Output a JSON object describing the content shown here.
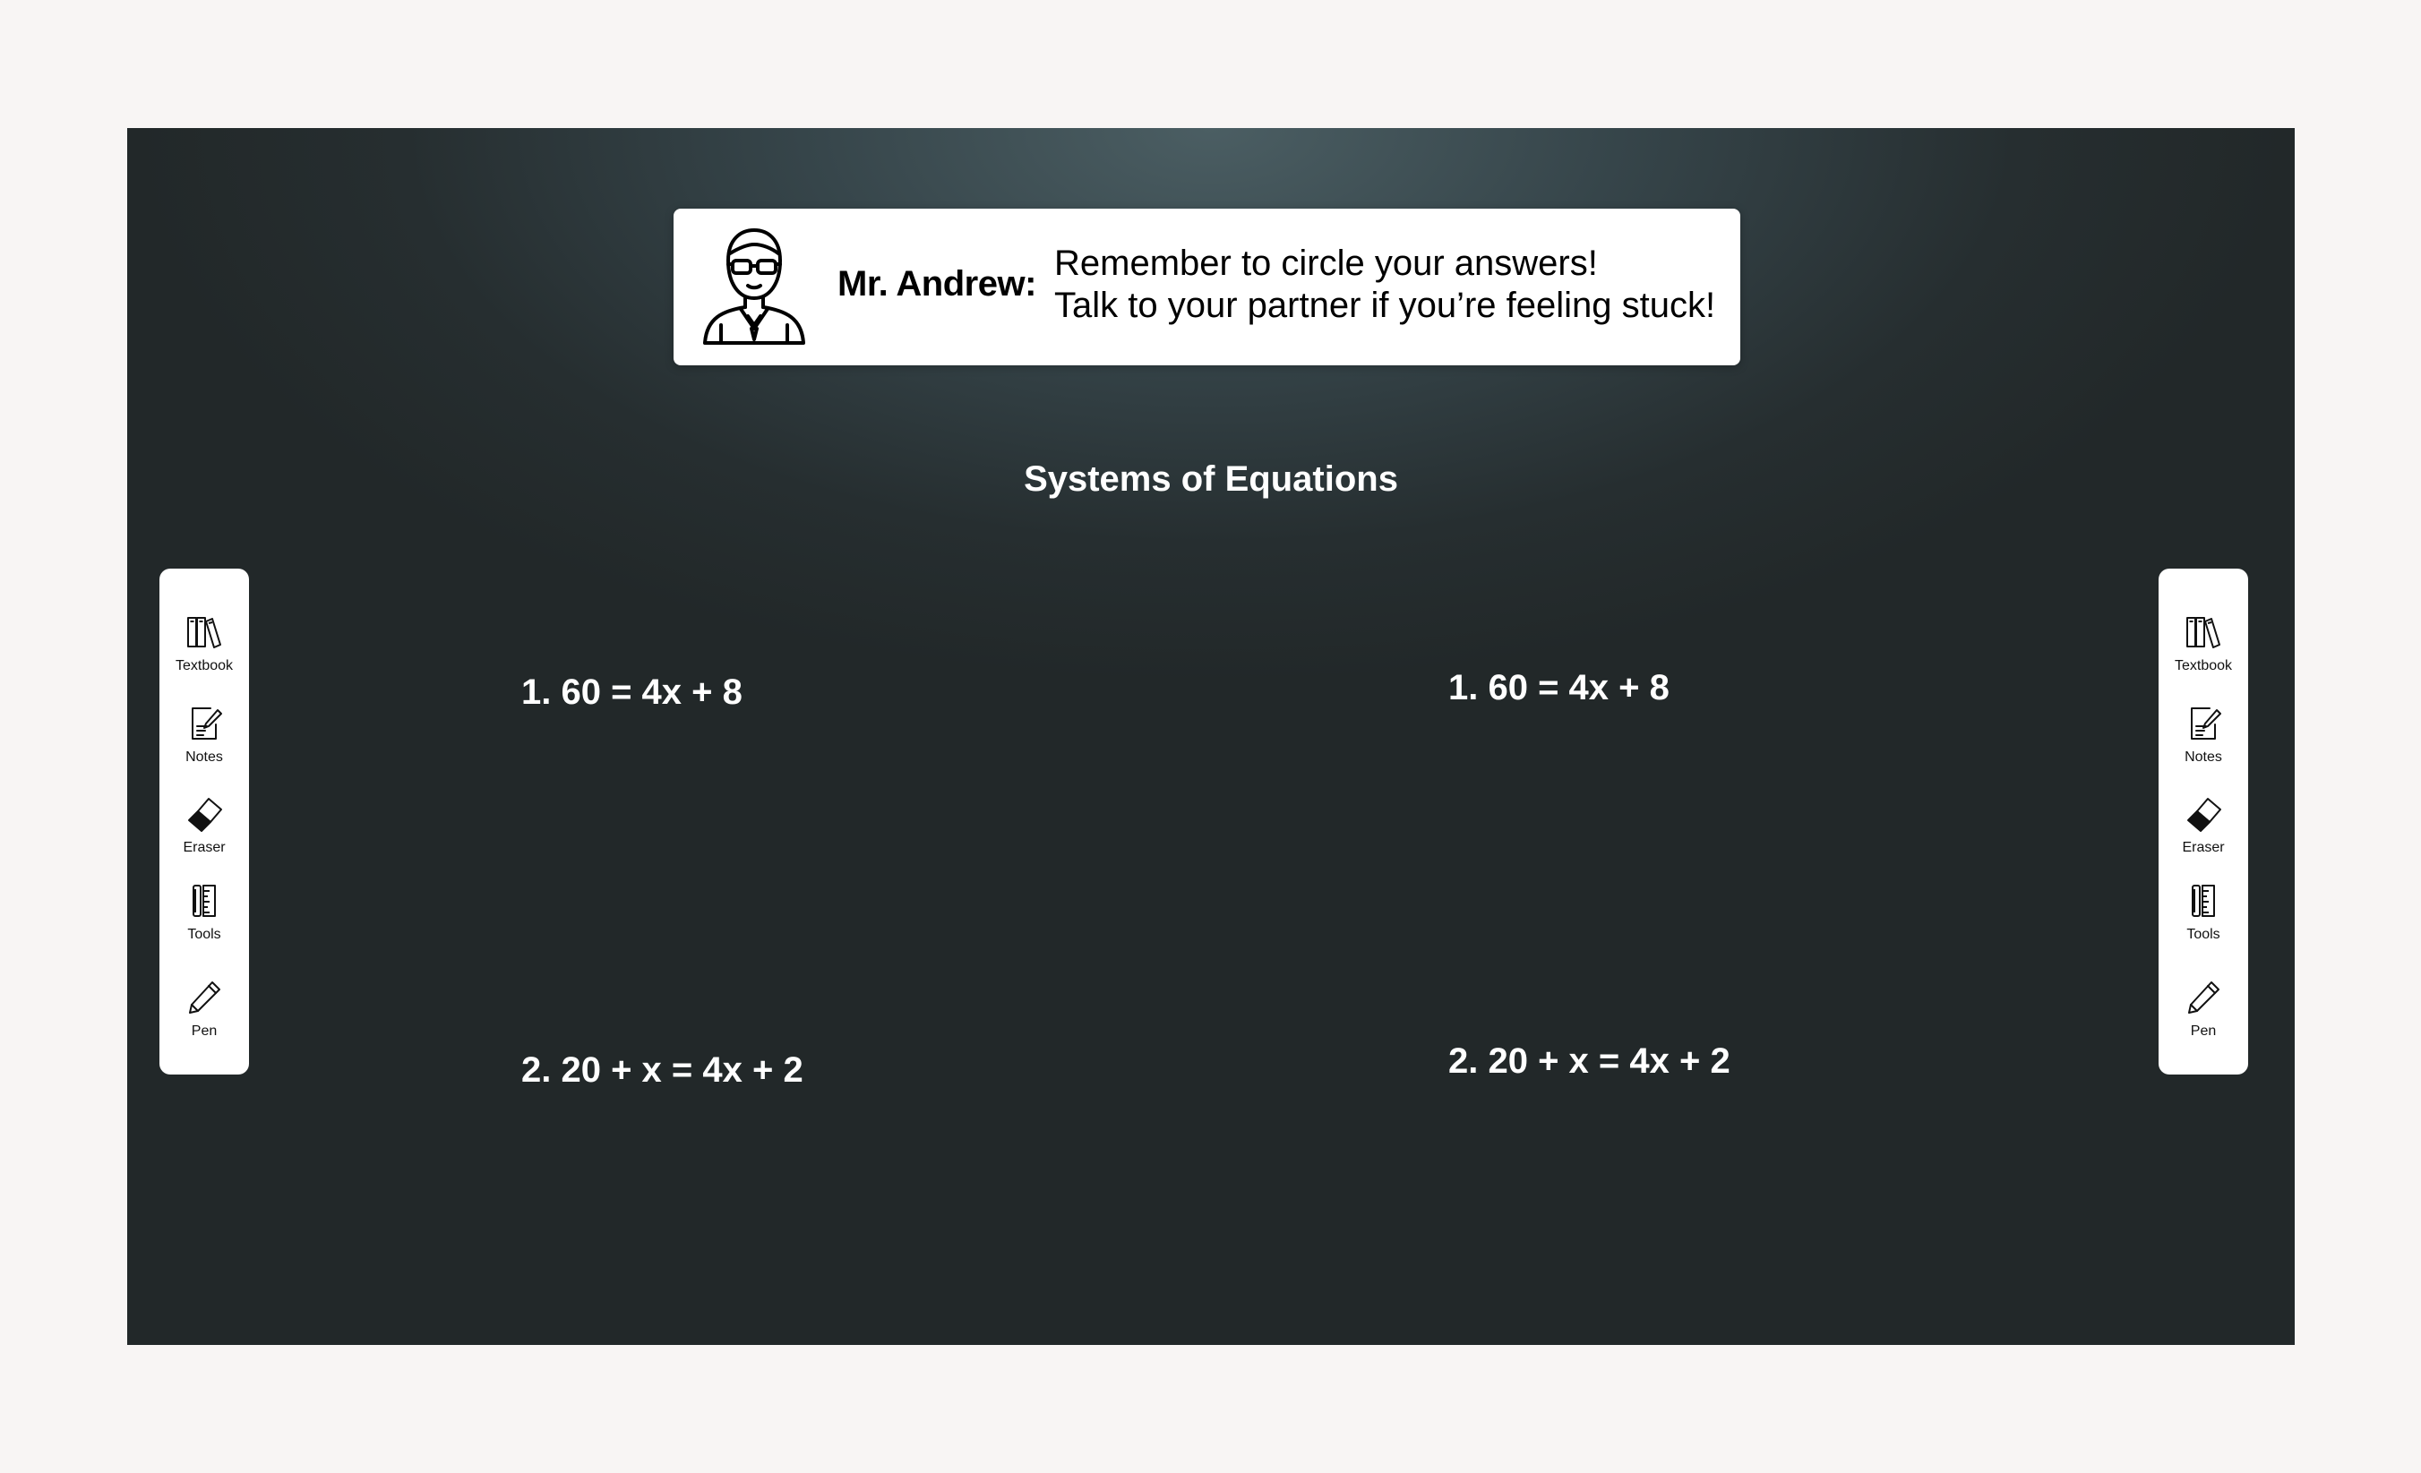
{
  "banner": {
    "teacher_name": "Mr. Andrew:",
    "messages": [
      "Remember to circle your answers!",
      "Talk to your partner if you’re feeling stuck!"
    ],
    "avatar_icon": "teacher-avatar-icon"
  },
  "board": {
    "title": "Systems of Equations",
    "left_column": {
      "equations": [
        "1. 60 = 4x + 8",
        "2. 20 + x = 4x + 2"
      ]
    },
    "right_column": {
      "equations": [
        "1. 60 = 4x + 8",
        "2. 20 + x = 4x + 2"
      ]
    }
  },
  "toolbar_left": {
    "items": [
      {
        "label": "Textbook",
        "icon": "textbook-icon"
      },
      {
        "label": "Notes",
        "icon": "notes-icon"
      },
      {
        "label": "Eraser",
        "icon": "eraser-icon"
      },
      {
        "label": "Tools",
        "icon": "tools-icon"
      },
      {
        "label": "Pen",
        "icon": "pen-icon"
      }
    ]
  },
  "toolbar_right": {
    "items": [
      {
        "label": "Textbook",
        "icon": "textbook-icon"
      },
      {
        "label": "Notes",
        "icon": "notes-icon"
      },
      {
        "label": "Eraser",
        "icon": "eraser-icon"
      },
      {
        "label": "Tools",
        "icon": "tools-icon"
      },
      {
        "label": "Pen",
        "icon": "pen-icon"
      }
    ]
  },
  "colors": {
    "page_background": "#f8f5f4",
    "board_background": "#222829",
    "board_highlight": "#4b5e63",
    "panel_background": "#ffffff",
    "board_text": "#ffffff"
  }
}
